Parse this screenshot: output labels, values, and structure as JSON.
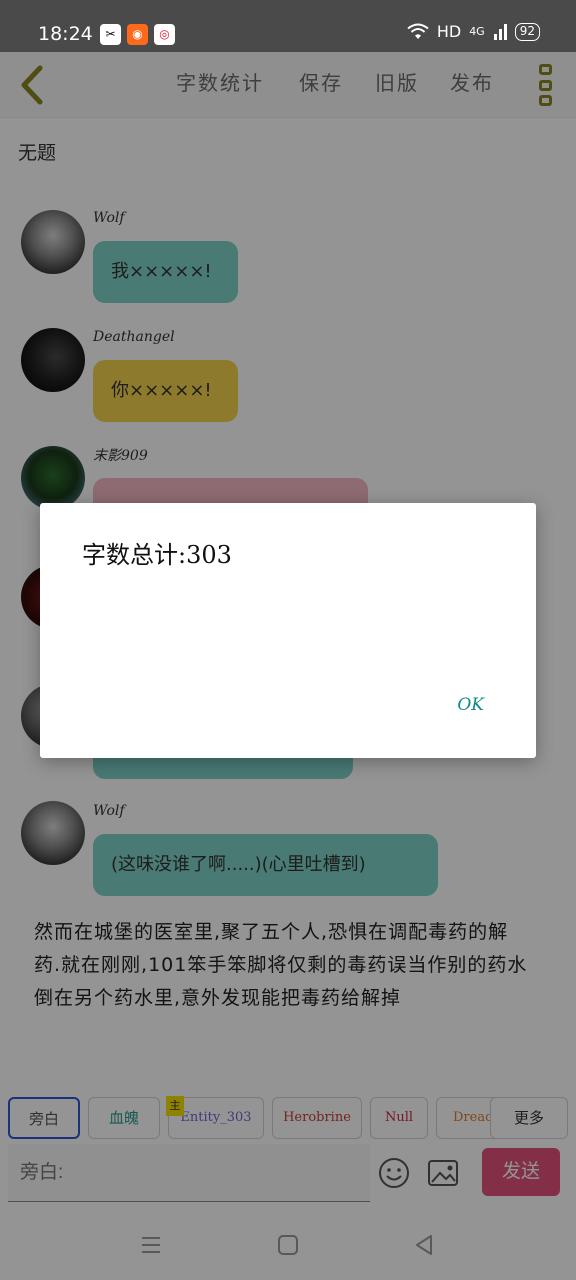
{
  "status_bar": {
    "time": "18:24",
    "network": "HD",
    "signal": "4G",
    "battery": "92"
  },
  "app_bar": {
    "word_count": "字数统计",
    "save": "保存",
    "old_version": "旧版",
    "publish": "发布"
  },
  "document": {
    "title": "无题"
  },
  "messages": [
    {
      "sender": "Wolf",
      "text": "我×××××!",
      "bubble_color": "#7fd3c8"
    },
    {
      "sender": "Deathangel",
      "text": "你×××××!",
      "bubble_color": "#f5d34d"
    },
    {
      "sender": "末影909",
      "text": "",
      "bubble_color": "#f4b7c4"
    },
    {
      "sender": "",
      "text": "",
      "bubble_color": "#7fd3c8"
    },
    {
      "sender": "Wolf",
      "text": "(这味没谁了啊.....)(心里吐槽到)",
      "bubble_color": "#7fd3c8"
    }
  ],
  "narration": "然而在城堡的医室里,聚了五个人,恐惧在调配毒药的解药.就在刚刚,101笨手笨脚将仅剩的毒药误当作别的药水倒在另个药水里,意外发现能把毒药给解掉",
  "role_chips": {
    "narrator": "旁白",
    "blood": "血魄",
    "entity": "Entity_303",
    "herobrine": "Herobrine",
    "null": "Null",
    "dread": "Dread",
    "more": "更多",
    "main_badge": "主"
  },
  "input": {
    "placeholder": "旁白:",
    "send": "发送"
  },
  "dialog": {
    "message": "字数总计:303",
    "ok": "OK"
  },
  "colors": {
    "accent_olive": "#8a8620",
    "send_button": "#e2527a",
    "selected_chip": "#2f55d4",
    "ok_text": "#0f8a86"
  }
}
